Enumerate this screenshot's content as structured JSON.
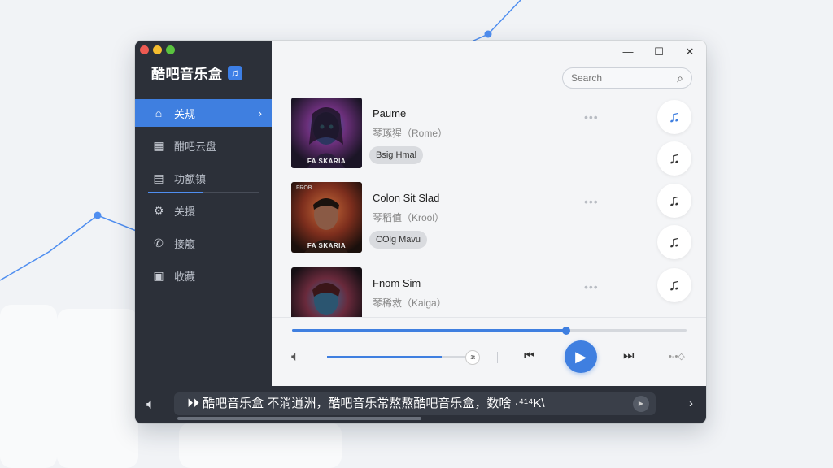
{
  "app": {
    "title": "酷吧音乐盒",
    "badge_glyph": "♫"
  },
  "window_controls": {
    "minimize": "—",
    "maximize": "☐",
    "close": "✕"
  },
  "sidebar": {
    "items": [
      {
        "label": "关规",
        "icon": "home-icon",
        "glyph": "⌂",
        "active": true
      },
      {
        "label": "酣吧云盘",
        "icon": "cloud-drive-icon",
        "glyph": "▦",
        "active": false
      },
      {
        "label": "功额镇",
        "icon": "calendar-icon",
        "glyph": "▤",
        "active": false
      },
      {
        "label": "关援",
        "icon": "settings-gear-icon",
        "glyph": "⚙",
        "active": false
      },
      {
        "label": "接箙",
        "icon": "phone-icon",
        "glyph": "✆",
        "active": false
      },
      {
        "label": "收藏",
        "icon": "monitor-icon",
        "glyph": "▣",
        "active": false
      }
    ],
    "progress": 0.5
  },
  "search": {
    "placeholder": "Search"
  },
  "tracks": [
    {
      "title": "Paume",
      "artist": "琴琢猩（Rome）",
      "tag": "Bsig Hmal",
      "cover_caption": "FA SKARIA",
      "cover_top": "",
      "more": "•••",
      "note": "♫",
      "highlighted": true
    },
    {
      "title": "Colon Sit Slad",
      "artist": "琴稻值（Krool）",
      "tag": "COlg Mavu",
      "cover_caption": "FA SKARIA",
      "cover_top": "FROB",
      "more": "•••",
      "note": "♫",
      "highlighted": false
    },
    {
      "title": "Fnom Sim",
      "artist": "琴稀救（Kaiga）",
      "tag": "",
      "cover_caption": "",
      "cover_top": "",
      "more": "•••",
      "note": "♫",
      "highlighted": false
    }
  ],
  "player": {
    "seek_progress": 0.695,
    "volume": 0.8,
    "volume_knob_label": "1t",
    "prev_glyph": "⏮",
    "play_glyph": "▶",
    "next_glyph": "⏭",
    "more_glyph": "•-•◇"
  },
  "bottombar": {
    "marquee_text": "⏵⏵ 酷吧音乐盒 不淌逍洲，酷吧音乐常熬熬酷吧音乐盒，数啥 ·⁴¹⁴Κ\\",
    "mini_play_glyph": "▶",
    "chevron": "›"
  },
  "colors": {
    "accent": "#3f7fe0",
    "sidebar_bg": "#2c3039",
    "content_bg": "#f4f5f7"
  }
}
